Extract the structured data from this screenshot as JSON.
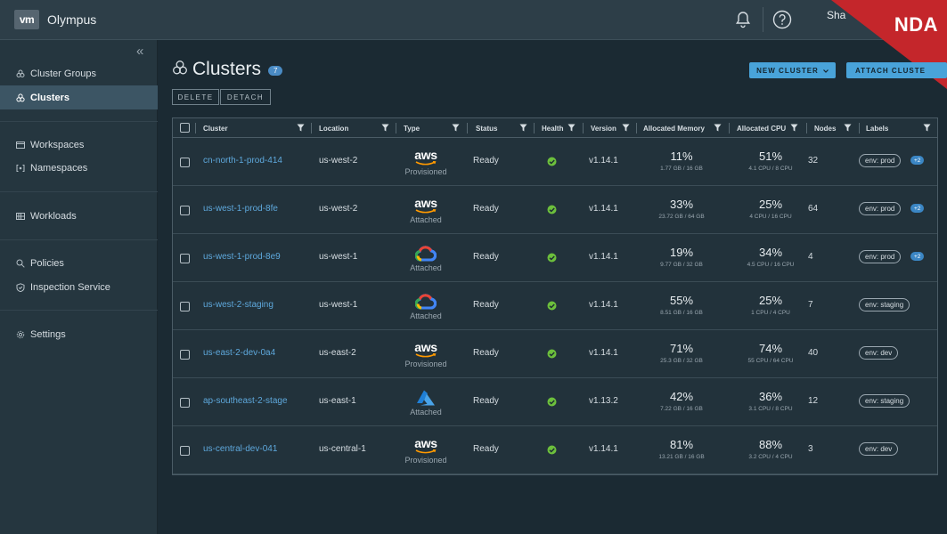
{
  "app": {
    "logo_text": "vm",
    "name": "Olympus",
    "user": "Sha",
    "nda_label": "NDA"
  },
  "sidebar": {
    "collapse_icon": "double-chevron-left",
    "items": [
      {
        "label": "Cluster Groups",
        "icon": "cluster-groups-icon",
        "active": false
      },
      {
        "label": "Clusters",
        "icon": "clusters-icon",
        "active": true
      },
      {
        "label": "Workspaces",
        "icon": "workspaces-icon",
        "active": false
      },
      {
        "label": "Namespaces",
        "icon": "namespaces-icon",
        "active": false
      },
      {
        "label": "Workloads",
        "icon": "workloads-icon",
        "active": false
      },
      {
        "label": "Policies",
        "icon": "policies-icon",
        "active": false
      },
      {
        "label": "Inspection Service",
        "icon": "inspection-icon",
        "active": false
      },
      {
        "label": "Settings",
        "icon": "settings-icon",
        "active": false
      }
    ]
  },
  "page": {
    "title": "Clusters",
    "count": "7",
    "actions": {
      "delete": "DELETE",
      "detach": "DETACH",
      "new_cluster": "NEW CLUSTER",
      "attach_cluster": "ATTACH CLUSTE"
    }
  },
  "table": {
    "columns": [
      "Cluster",
      "Location",
      "Type",
      "Status",
      "Health",
      "Version",
      "Allocated Memory",
      "Allocated CPU",
      "Nodes",
      "Labels"
    ],
    "rows": [
      {
        "cluster": "cn-north-1-prod-414",
        "location": "us-west-2",
        "provider": "aws",
        "type": "Provisioned",
        "status": "Ready",
        "version": "v1.14.1",
        "mem_pct": "11%",
        "mem_detail": "1.77 GB / 16 GB",
        "cpu_pct": "51%",
        "cpu_detail": "4.1 CPU / 8 CPU",
        "nodes": "32",
        "label": "env: prod",
        "extra": "+2"
      },
      {
        "cluster": "us-west-1-prod-8fe",
        "location": "us-west-2",
        "provider": "aws",
        "type": "Attached",
        "status": "Ready",
        "version": "v1.14.1",
        "mem_pct": "33%",
        "mem_detail": "23.72 GB / 64 GB",
        "cpu_pct": "25%",
        "cpu_detail": "4 CPU / 16 CPU",
        "nodes": "64",
        "label": "env: prod",
        "extra": "+2"
      },
      {
        "cluster": "us-west-1-prod-8e9",
        "location": "us-west-1",
        "provider": "gcp",
        "type": "Attached",
        "status": "Ready",
        "version": "v1.14.1",
        "mem_pct": "19%",
        "mem_detail": "9.77 GB / 32 GB",
        "cpu_pct": "34%",
        "cpu_detail": "4.5 CPU / 16 CPU",
        "nodes": "4",
        "label": "env: prod",
        "extra": "+2"
      },
      {
        "cluster": "us-west-2-staging",
        "location": "us-west-1",
        "provider": "gcp",
        "type": "Attached",
        "status": "Ready",
        "version": "v1.14.1",
        "mem_pct": "55%",
        "mem_detail": "8.51 GB / 16 GB",
        "cpu_pct": "25%",
        "cpu_detail": "1 CPU / 4 CPU",
        "nodes": "7",
        "label": "env: staging",
        "extra": ""
      },
      {
        "cluster": "us-east-2-dev-0a4",
        "location": "us-east-2",
        "provider": "aws",
        "type": "Provisioned",
        "status": "Ready",
        "version": "v1.14.1",
        "mem_pct": "71%",
        "mem_detail": "25.3 GB / 32 GB",
        "cpu_pct": "74%",
        "cpu_detail": "55 CPU / 64 CPU",
        "nodes": "40",
        "label": "env: dev",
        "extra": ""
      },
      {
        "cluster": "ap-southeast-2-stage",
        "location": "us-east-1",
        "provider": "azure",
        "type": "Attached",
        "status": "Ready",
        "version": "v1.13.2",
        "mem_pct": "42%",
        "mem_detail": "7.22 GB / 16 GB",
        "cpu_pct": "36%",
        "cpu_detail": "3.1 CPU / 8 CPU",
        "nodes": "12",
        "label": "env: staging",
        "extra": ""
      },
      {
        "cluster": "us-central-dev-041",
        "location": "us-central-1",
        "provider": "aws",
        "type": "Provisioned",
        "status": "Ready",
        "version": "v1.14.1",
        "mem_pct": "81%",
        "mem_detail": "13.21 GB / 16 GB",
        "cpu_pct": "88%",
        "cpu_detail": "3.2 CPU / 4 CPU",
        "nodes": "3",
        "label": "env: dev",
        "extra": ""
      }
    ]
  },
  "colors": {
    "link": "#5ea8dc",
    "primary": "#49a3d9",
    "health_ok": "#6cbf3c",
    "nda": "#c4262b"
  }
}
